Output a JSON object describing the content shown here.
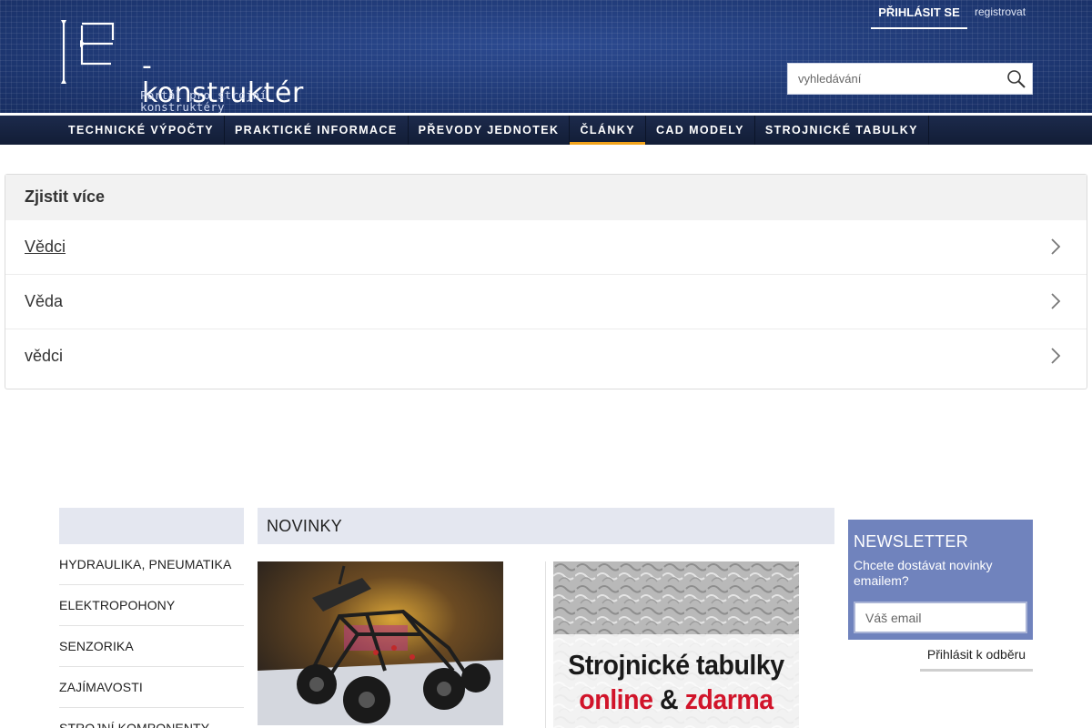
{
  "header": {
    "logo_text": "-konstruktér",
    "logo_subtitle": "Portál pro strojní konstruktéry",
    "login_label": "PŘIHLÁSIT SE",
    "register_label": "registrovat",
    "search_placeholder": "vyhledávání",
    "icons": [
      "logo-frame-icon",
      "search-icon"
    ]
  },
  "nav": {
    "items": [
      {
        "label": "TECHNICKÉ VÝPOČTY",
        "active": false
      },
      {
        "label": "PRAKTICKÉ INFORMACE",
        "active": false
      },
      {
        "label": "PŘEVODY JEDNOTEK",
        "active": false
      },
      {
        "label": "ČLÁNKY",
        "active": true
      },
      {
        "label": "CAD MODELY",
        "active": false
      },
      {
        "label": "STROJNICKÉ TABULKY",
        "active": false
      }
    ],
    "active_color": "#f2a31b"
  },
  "more": {
    "title": "Zjistit více",
    "items": [
      {
        "label": "Vědci"
      },
      {
        "label": "Věda"
      },
      {
        "label": "vědci"
      }
    ],
    "icon": "chevron-right-icon"
  },
  "categories": {
    "items": [
      "HYDRAULIKA, PNEUMATIKA",
      "ELEKTROPOHONY",
      "SENZORIKA",
      "ZAJÍMAVOSTI",
      "STROJNÍ KOMPONENTY"
    ]
  },
  "news": {
    "title": "NOVINKY",
    "card2": {
      "line1": "Strojnické tabulky",
      "line2a": "online",
      "line2b": "&",
      "line2c": "zdarma"
    }
  },
  "newsletter": {
    "title": "NEWSLETTER",
    "text": "Chcete dostávat novinky emailem?",
    "email_placeholder": "Váš email",
    "submit_label": "Přihlásit k odběru"
  },
  "colors": {
    "header_bg": "#203a78",
    "nav_bg": "#1c2a4c",
    "newsletter_bg": "#7083bd",
    "accent_red": "#d1142a"
  }
}
